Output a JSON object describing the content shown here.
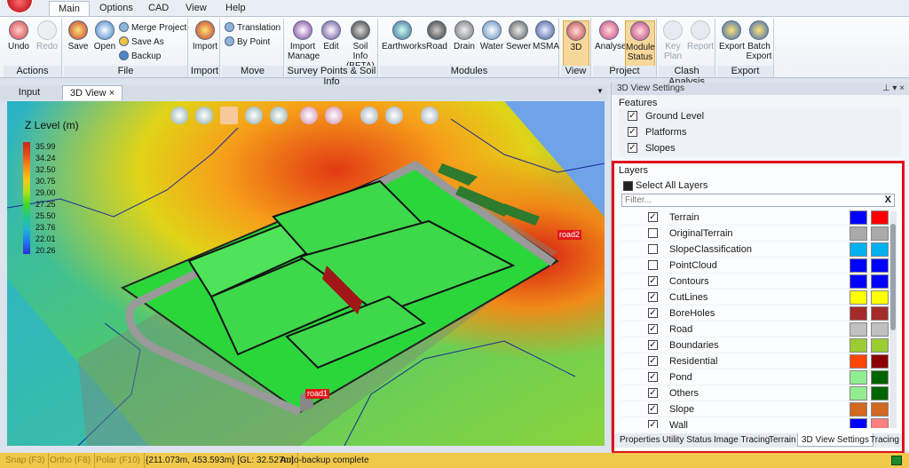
{
  "app": {
    "logo": "app-logo"
  },
  "ribbon_tabs": [
    "Main",
    "Options",
    "CAD",
    "View",
    "Help"
  ],
  "ribbon": {
    "actions": {
      "label": "Actions",
      "undo": "Undo",
      "redo": "Redo"
    },
    "file": {
      "label": "File",
      "save": "Save",
      "open": "Open",
      "merge": "Merge Project",
      "save_as": "Save As",
      "backup": "Backup"
    },
    "import_grp": {
      "label": "Import",
      "import": "Import"
    },
    "move": {
      "label": "Move",
      "translation": "Translation",
      "by_point": "By Point"
    },
    "survey": {
      "label": "Survey Points & Soil Info",
      "import_manage": "Import Manage",
      "edit": "Edit",
      "soil_info": "Soil Info (BETA)"
    },
    "modules": {
      "label": "Modules",
      "earthworks": "Earthworks",
      "road": "Road",
      "drain": "Drain",
      "water": "Water",
      "sewer": "Sewer",
      "msma": "MSMA"
    },
    "view": {
      "label": "View",
      "threed": "3D"
    },
    "project": {
      "label": "Project",
      "analyse": "Analyse",
      "module_status": "Module Status"
    },
    "clash": {
      "label": "Clash Analysis",
      "key_plan": "Key Plan",
      "report": "Report"
    },
    "export": {
      "label": "Export",
      "export": "Export",
      "batch_export": "Batch Export"
    }
  },
  "doc_tabs": {
    "input": "Input",
    "view3d": "3D View",
    "close": "×"
  },
  "viewport": {
    "legend_title": "Z Level (m)",
    "legend_values": [
      "35.99",
      "34.24",
      "32.50",
      "30.75",
      "29.00",
      "27.25",
      "25.50",
      "23.76",
      "22.01",
      "20.26"
    ],
    "road1": "road1",
    "road2": "road2"
  },
  "panel": {
    "title": "3D View Settings",
    "pin": "⊥ ▾ ×",
    "features_label": "Features",
    "features": [
      {
        "label": "Ground Level",
        "checked": true
      },
      {
        "label": "Platforms",
        "checked": true
      },
      {
        "label": "Slopes",
        "checked": true
      }
    ],
    "layers_label": "Layers",
    "select_all": "Select All Layers",
    "filter_placeholder": "Filter...",
    "filter_clear": "X",
    "layers": [
      {
        "label": "Terrain",
        "checked": true,
        "c1": "#0000ff",
        "c2": "#ff0000"
      },
      {
        "label": "OriginalTerrain",
        "checked": false,
        "c1": "#a9a9a9",
        "c2": "#a9a9a9"
      },
      {
        "label": "SlopeClassification",
        "checked": false,
        "c1": "#00b0f0",
        "c2": "#00b0f0"
      },
      {
        "label": "PointCloud",
        "checked": false,
        "c1": "#0000ff",
        "c2": "#0000ff"
      },
      {
        "label": "Contours",
        "checked": true,
        "c1": "#0000ff",
        "c2": "#0000ff"
      },
      {
        "label": "CutLines",
        "checked": true,
        "c1": "#ffff00",
        "c2": "#ffff00"
      },
      {
        "label": "BoreHoles",
        "checked": true,
        "c1": "#a52a2a",
        "c2": "#a52a2a"
      },
      {
        "label": "Road",
        "checked": true,
        "c1": "#c0c0c0",
        "c2": "#c0c0c0"
      },
      {
        "label": "Boundaries",
        "checked": true,
        "c1": "#9acd32",
        "c2": "#9acd32"
      },
      {
        "label": "Residential",
        "checked": true,
        "c1": "#ff4500",
        "c2": "#8b0000"
      },
      {
        "label": "Pond",
        "checked": true,
        "c1": "#90ee90",
        "c2": "#006400"
      },
      {
        "label": "Others",
        "checked": true,
        "c1": "#90ee90",
        "c2": "#006400"
      },
      {
        "label": "Slope",
        "checked": true,
        "c1": "#d2691e",
        "c2": "#d2691e"
      },
      {
        "label": "Wall",
        "checked": true,
        "c1": "#0000ff",
        "c2": "#ff8080"
      }
    ],
    "bottom_tabs": [
      "Properties",
      "Utility Status",
      "Image Tracing",
      "Terrain",
      "3D View Settings",
      "Tracing"
    ]
  },
  "status": {
    "snap": "Snap (F3)",
    "ortho": "Ortho (F8)",
    "polar": "Polar (F10)",
    "coords": "{211.073m, 453.593m} [GL: 32.527m]",
    "message": "Auto-backup complete"
  }
}
